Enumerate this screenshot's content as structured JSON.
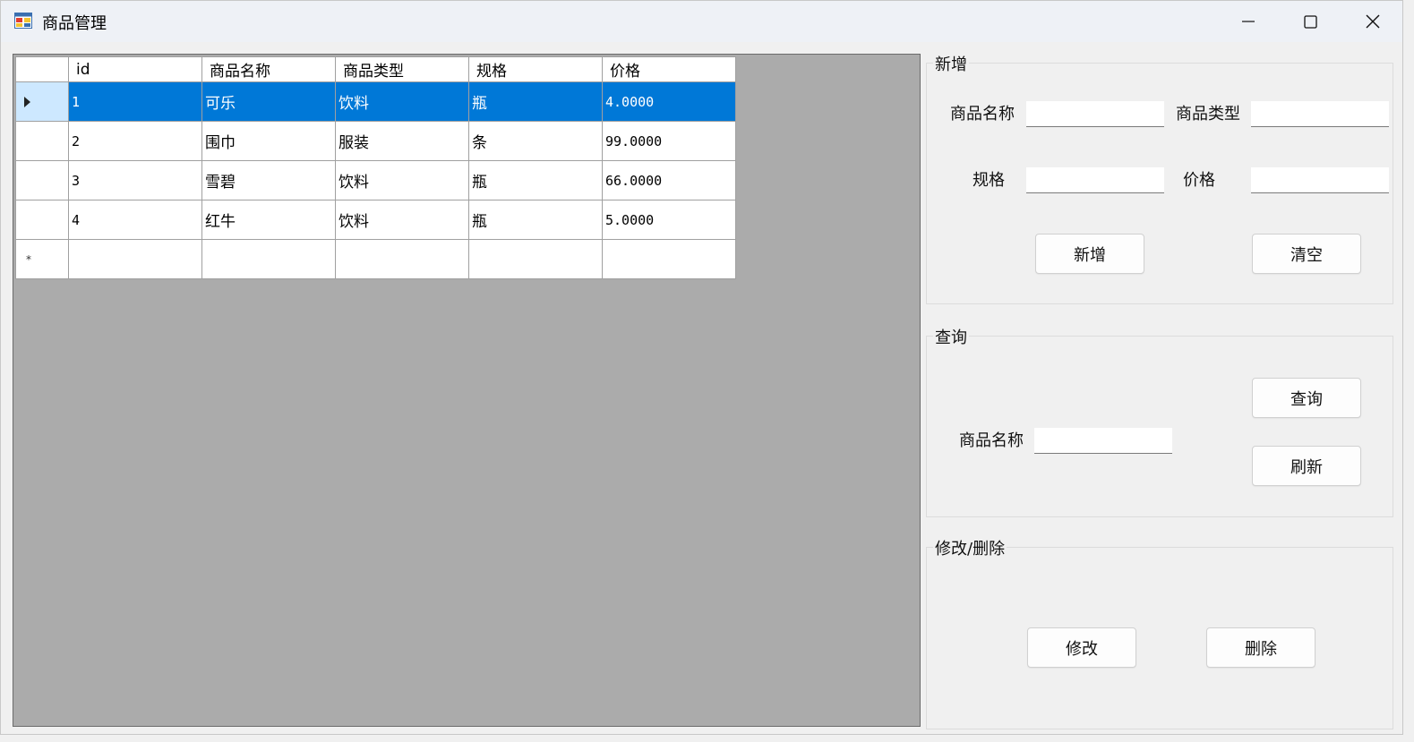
{
  "window": {
    "title": "商品管理",
    "icons": [
      "app-icon",
      "minimize-icon",
      "maximize-icon",
      "close-icon"
    ]
  },
  "grid": {
    "columns": [
      "id",
      "商品名称",
      "商品类型",
      "规格",
      "价格"
    ],
    "rows": [
      {
        "id": "1",
        "name": "可乐",
        "type": "饮料",
        "spec": "瓶",
        "price": "4.0000",
        "selected": true
      },
      {
        "id": "2",
        "name": "围巾",
        "type": "服装",
        "spec": "条",
        "price": "99.0000",
        "selected": false
      },
      {
        "id": "3",
        "name": "雪碧",
        "type": "饮料",
        "spec": "瓶",
        "price": "66.0000",
        "selected": false
      },
      {
        "id": "4",
        "name": "红牛",
        "type": "饮料",
        "spec": "瓶",
        "price": "5.0000",
        "selected": false
      }
    ],
    "new_row_marker": "*",
    "selection_color": "#0078d7"
  },
  "add_group": {
    "title": "新增",
    "name_label": "商品名称",
    "type_label": "商品类型",
    "spec_label": "规格",
    "price_label": "价格",
    "name_value": "",
    "type_value": "",
    "spec_value": "",
    "price_value": "",
    "add_button": "新增",
    "clear_button": "清空"
  },
  "query_group": {
    "title": "查询",
    "name_label": "商品名称",
    "name_value": "",
    "query_button": "查询",
    "refresh_button": "刷新"
  },
  "edit_group": {
    "title": "修改/删除",
    "edit_button": "修改",
    "delete_button": "删除"
  }
}
